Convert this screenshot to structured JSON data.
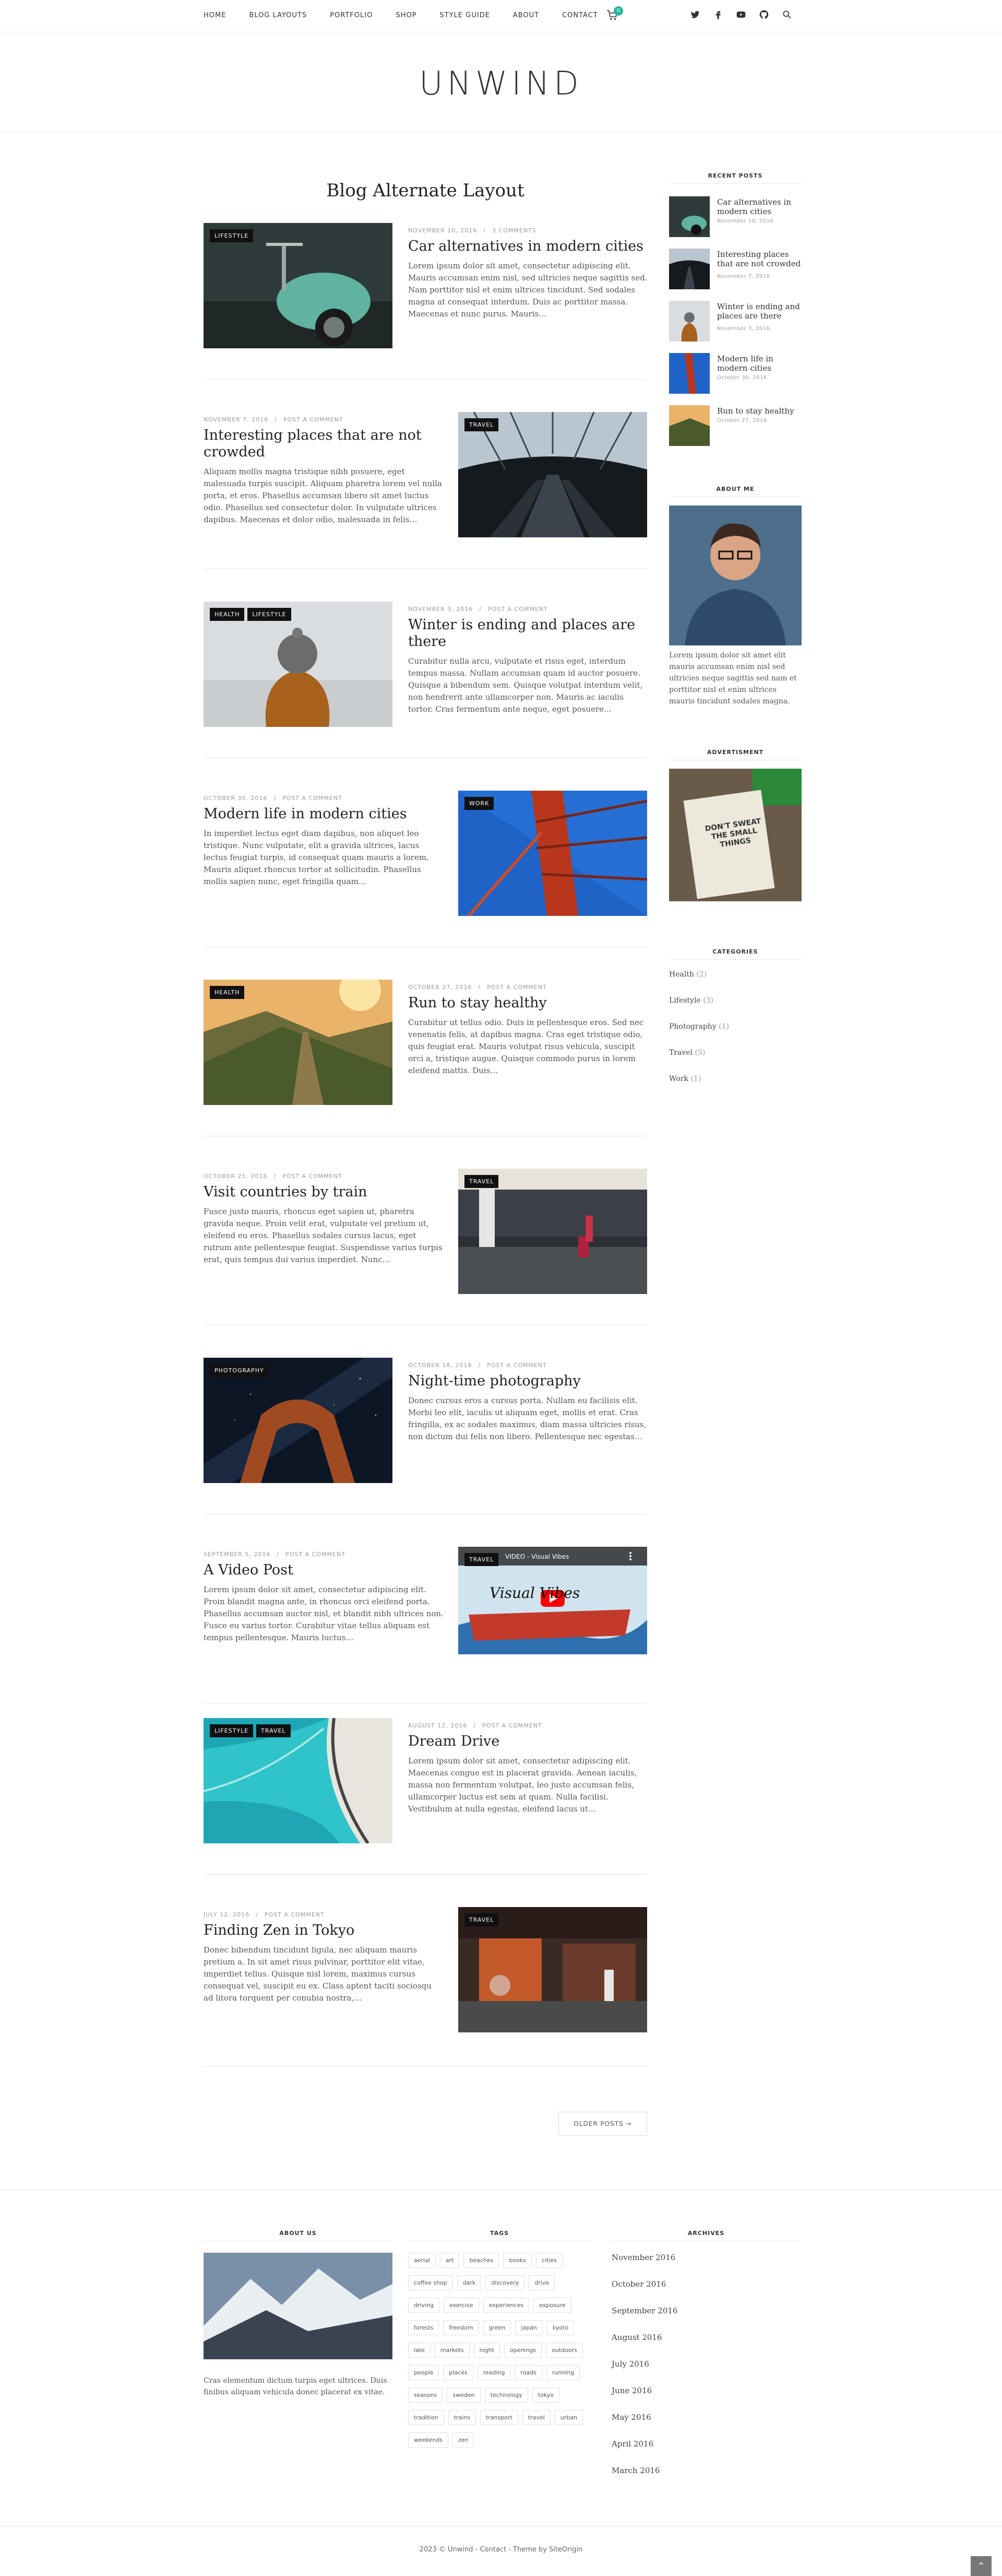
{
  "nav": {
    "items": [
      "HOME",
      "BLOG LAYOUTS",
      "PORTFOLIO",
      "SHOP",
      "STYLE GUIDE",
      "ABOUT",
      "CONTACT"
    ],
    "cart_count": "0",
    "social_icons": [
      "twitter-icon",
      "facebook-icon",
      "youtube-icon",
      "github-icon",
      "search-icon"
    ]
  },
  "site": {
    "logo": "UNWIND"
  },
  "main": {
    "title": "Blog Alternate Layout",
    "posts": [
      {
        "badges": [
          "LIFESTYLE"
        ],
        "date": "NOVEMBER 10, 2016",
        "comments": "3 COMMENTS",
        "title": "Car alternatives in modern cities",
        "excerpt": "Lorem ipsum dolor sit amet, consectetur adipiscing elit. Mauris accumsan enim nisl, sed ultricies neque sagittis sed. Nam porttitor nisl et enim ultrices tincidunt. Sed sodales magna at consequat interdum. Duis ac porttitor massa. Maecenas et nunc purus. Mauris…"
      },
      {
        "badges": [
          "TRAVEL"
        ],
        "date": "NOVEMBER 7, 2016",
        "comments": "POST A COMMENT",
        "title": "Interesting places that are not crowded",
        "excerpt": "Aliquam mollis magna tristique nibh posuere, eget malesuada turpis suscipit. Aliquam pharetra lorem vel nulla porta, et eros. Phasellus accumsan libero sit amet luctus odio. Phasellus sed consectetur dolor. In vulputate ultrices dapibus. Maecenas et dolor odio, malesuada in felis…"
      },
      {
        "badges": [
          "HEALTH",
          "LIFESTYLE"
        ],
        "date": "NOVEMBER 3, 2016",
        "comments": "POST A COMMENT",
        "title": "Winter is ending and places are there",
        "excerpt": "Curabitur nulla arcu, vulputate et risus eget, interdum tempus massa. Nullam accumsan quam id auctor posuere. Quisque a bibendum sem. Quisque volutpat interdum velit, non hendrerit ante ullamcorper non. Mauris ac iaculis tortor. Cras fermentum ante neque, eget posuere…"
      },
      {
        "badges": [
          "WORK"
        ],
        "date": "OCTOBER 30, 2016",
        "comments": "POST A COMMENT",
        "title": "Modern life in modern cities",
        "excerpt": "In imperdiet lectus eget diam dapibus, non aliquet leo tristique. Nunc vulputate, elit a gravida ultrices, lacus lectus feugiat turpis, id consequat quam mauris a lorem. Mauris aliquet rhoncus tortor at sollicitudin. Phasellus mollis sapien nunc, eget fringilla quam…"
      },
      {
        "badges": [
          "HEALTH"
        ],
        "date": "OCTOBER 27, 2016",
        "comments": "POST A COMMENT",
        "title": "Run to stay healthy",
        "excerpt": "Curabitur ut tellus odio. Duis in pellentesque eros. Sed nec venenatis felis, at dapibus magna. Cras eget tristique odio, quis feugiat erat. Mauris volutpat risus vehicula, suscipit orci a, tristique augue. Quisque commodo purus in lorem eleifend mattis. Duis…"
      },
      {
        "badges": [
          "TRAVEL"
        ],
        "date": "OCTOBER 25, 2016",
        "comments": "POST A COMMENT",
        "title": "Visit countries by train",
        "excerpt": "Fusce justo mauris, rhoncus eget sapien ut, pharetra gravida neque. Proin velit erat, vulputate vel pretium ut, eleifend eu eros. Phasellus sodales cursus lacus, eget rutrum ante pellentesque feugiat. Suspendisse varius turpis erat, quis tempus dui varius imperdiet. Nunc…"
      },
      {
        "badges": [
          "PHOTOGRAPHY"
        ],
        "date": "OCTOBER 18, 2016",
        "comments": "POST A COMMENT",
        "title": "Night-time photography",
        "excerpt": "Donec cursus eros a cursus porta. Nullam eu facilisis elit. Morbi leo elit, iaculis ut aliquam eget, mollis et erat. Cras fringilla, ex ac sodales maximus, diam massa ultricies risus, non dictum dui felis non libero. Pellentesque nec egestas…"
      },
      {
        "badges": [
          "TRAVEL"
        ],
        "date": "SEPTEMBER 5, 2016",
        "comments": "POST A COMMENT",
        "title": "A Video Post",
        "excerpt": "Lorem ipsum dolor sit amet, consectetur adipiscing elit. Proin blandit magna ante, in rhoncus orci eleifend porta. Phasellus accumsan auctor nisl, et blandit nibh ultrices non. Fusce eu varius tortor. Curabitur vitae tellus aliquam est tempus pellentesque. Mauris luctus…",
        "video_title": "VIDEO - Visual Vibes",
        "video_overlay": "Visual Vibes"
      },
      {
        "badges": [
          "LIFESTYLE",
          "TRAVEL"
        ],
        "date": "AUGUST 12, 2016",
        "comments": "POST A COMMENT",
        "title": "Dream Drive",
        "excerpt": "Lorem ipsum dolor sit amet, consectetur adipiscing elit. Maecenas congue est in placerat gravida. Aenean iaculis, massa non fermentum volutpat, leo justo accumsan felis, ullamcorper luctus est sem at quam. Nulla facilisi. Vestibulum at nulla egestas, eleifend lacus ut…"
      },
      {
        "badges": [
          "TRAVEL"
        ],
        "date": "JULY 12, 2016",
        "comments": "POST A COMMENT",
        "title": "Finding Zen in Tokyo",
        "excerpt": "Donec bibendum tincidunt ligula, nec aliquam mauris pretium a. In sit amet risus pulvinar, porttitor elit vitae, imperdiet tellus. Quisque nisl lorem, maximus cursus consequat vel, suscipit eu ex. Class aptent taciti sociosqu ad litora torquent per conubia nostra,…"
      }
    ],
    "older_posts": "OLDER POSTS →"
  },
  "sidebar": {
    "recent_title": "RECENT POSTS",
    "recent": [
      {
        "title": "Car alternatives in modern cities",
        "date": "November 10, 2016"
      },
      {
        "title": "Interesting places that are not crowded",
        "date": "November 7, 2016"
      },
      {
        "title": "Winter is ending and places are there",
        "date": "November 3, 2016"
      },
      {
        "title": "Modern life in modern cities",
        "date": "October 30, 2016"
      },
      {
        "title": "Run to stay healthy",
        "date": "October 27, 2016"
      }
    ],
    "about_title": "ABOUT ME",
    "about_text": "Lorem ipsum dolor sit amet elit mauris accumsan enim nisl sed ultricies neque sagittis sed nam et porttitor nisl et enim ultrices mauris tincidunt sodales magna.",
    "ad_title": "ADVERTISMENT",
    "ad_sign": "DON'T SWEAT THE SMALL THINGS",
    "categories_title": "CATEGORIES",
    "categories": [
      {
        "name": "Health",
        "count": "(2)"
      },
      {
        "name": "Lifestyle",
        "count": "(3)"
      },
      {
        "name": "Photography",
        "count": "(1)"
      },
      {
        "name": "Travel",
        "count": "(5)"
      },
      {
        "name": "Work",
        "count": "(1)"
      }
    ]
  },
  "footer": {
    "about_title": "ABOUT US",
    "about_text": "Cras elementum dictum turpis eget ultrices. Duis finibus aliquam vehicula donec placerat ex vitae.",
    "tags_title": "TAGS",
    "tags": [
      "aerial",
      "art",
      "beaches",
      "books",
      "cities",
      "coffee shop",
      "dark",
      "discovery",
      "drive",
      "driving",
      "exercise",
      "experiences",
      "exposure",
      "forests",
      "freedom",
      "green",
      "japan",
      "kyoto",
      "late",
      "markets",
      "night",
      "openings",
      "outdoors",
      "people",
      "places",
      "reading",
      "roads",
      "running",
      "seasons",
      "sweden",
      "technology",
      "tokyo",
      "tradition",
      "trains",
      "transport",
      "travel",
      "urban",
      "weekends",
      "zen"
    ],
    "archives_title": "ARCHIVES",
    "archives": [
      "November 2016",
      "October 2016",
      "September 2016",
      "August 2016",
      "July 2016",
      "June 2016",
      "May 2016",
      "April 2016",
      "March 2016"
    ],
    "copyright": "2023 © Unwind - Contact - Theme by SiteOrigin",
    "to_top": "⌃"
  }
}
